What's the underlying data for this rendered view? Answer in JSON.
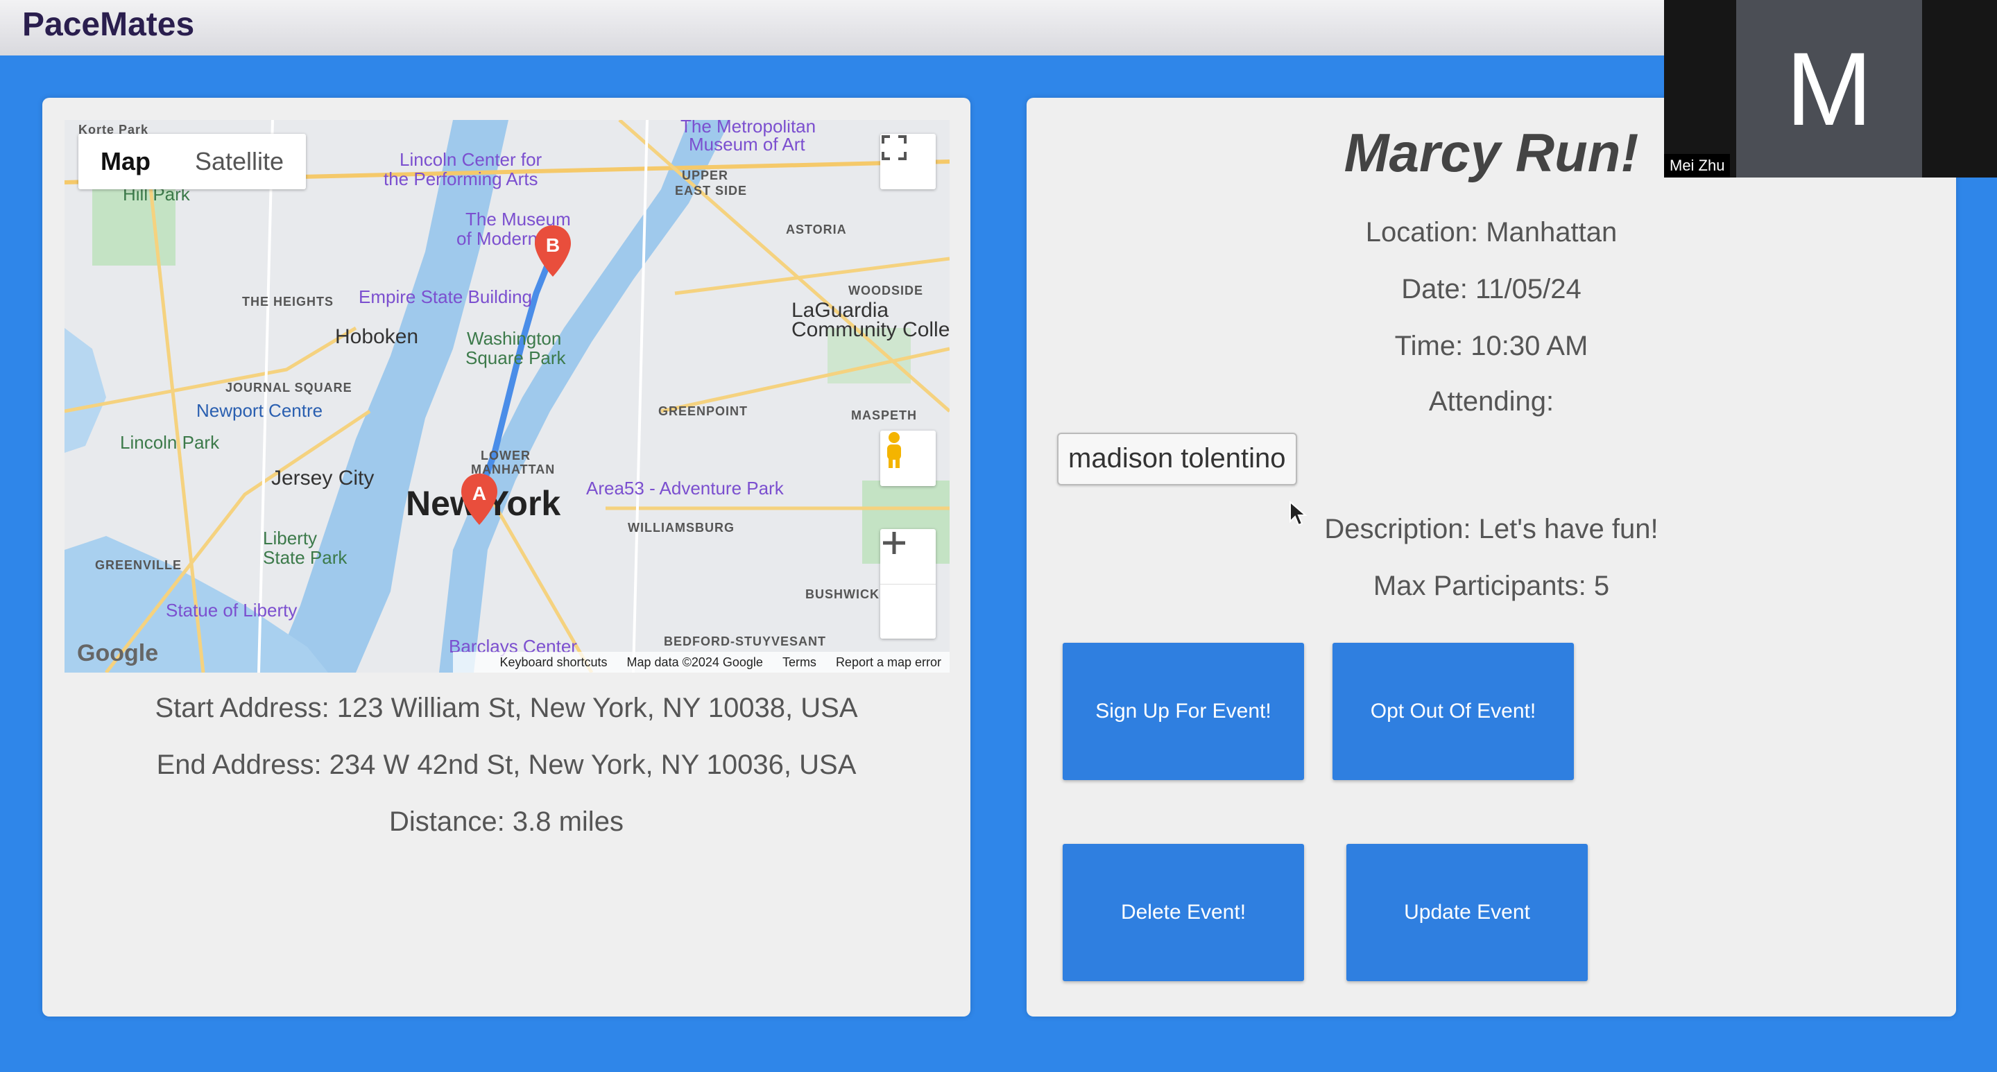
{
  "app": {
    "title": "PaceMates"
  },
  "map": {
    "type_buttons": [
      "Map",
      "Satellite"
    ],
    "labels": {
      "hoboken": "Hoboken",
      "jersey_city": "Jersey City",
      "new_york": "New York",
      "lincoln_center": "Lincoln Center for",
      "lincoln_center_2": "the Performing Arts",
      "museum": "The Museum",
      "museum_2": "of Modern Art",
      "met": "The Metropolitan",
      "met_2": "Museum of Art",
      "empire": "Empire State Building",
      "washington": "Washington",
      "washington_2": "Square Park",
      "newport": "Newport Centre",
      "lincoln_park": "Lincoln Park",
      "liberty_park": "Liberty",
      "liberty_park_2": "State Park",
      "statue": "Statue of Liberty",
      "barclays": "Barclays Center",
      "area53": "Area53 - Adventure Park",
      "laguardia": "LaGuardia",
      "laguardia_2": "Community Colleg",
      "upper_east": "UPPER",
      "upper_east_2": "EAST SIDE",
      "astoria": "ASTORIA",
      "woodside": "WOODSIDE",
      "heights": "THE HEIGHTS",
      "journal": "JOURNAL SQUARE",
      "greenpoint": "GREENPOINT",
      "maspeth": "MASPETH",
      "lower_manhattan": "LOWER",
      "lower_manhattan_2": "MANHATTAN",
      "williamsburg": "WILLIAMSBURG",
      "bushwick": "BUSHWICK",
      "bedford": "BEDFORD-STUYVESANT",
      "greenville": "GREENVILLE",
      "hill_park": "Hill Park",
      "corte_park": "Korte Park"
    },
    "marker_a": "A",
    "marker_b": "B",
    "google": "Google",
    "footer": [
      "Keyboard shortcuts",
      "Map data ©2024 Google",
      "Terms",
      "Report a map error"
    ]
  },
  "route": {
    "start": "Start Address: 123 William St, New York, NY 10038, USA",
    "end": "End Address: 234 W 42nd St, New York, NY 10036, USA",
    "distance": "Distance: 3.8 miles"
  },
  "event": {
    "title": "Marcy Run!",
    "location": "Location: Manhattan",
    "date": "Date: 11/05/24",
    "time": "Time: 10:30 AM",
    "attending_label": "Attending:",
    "attendees": [
      "madison tolentino"
    ],
    "description": "Description: Let's have fun!",
    "max_participants": "Max Participants: 5"
  },
  "buttons": {
    "sign_up": "Sign Up For Event!",
    "opt_out": "Opt Out Of Event!",
    "delete": "Delete Event!",
    "update": "Update Event"
  },
  "video": {
    "letter": "M",
    "name": "Mei Zhu"
  },
  "colors": {
    "background": "#2f86e9",
    "button": "#2f7fe0",
    "title": "#2a1e4e"
  }
}
